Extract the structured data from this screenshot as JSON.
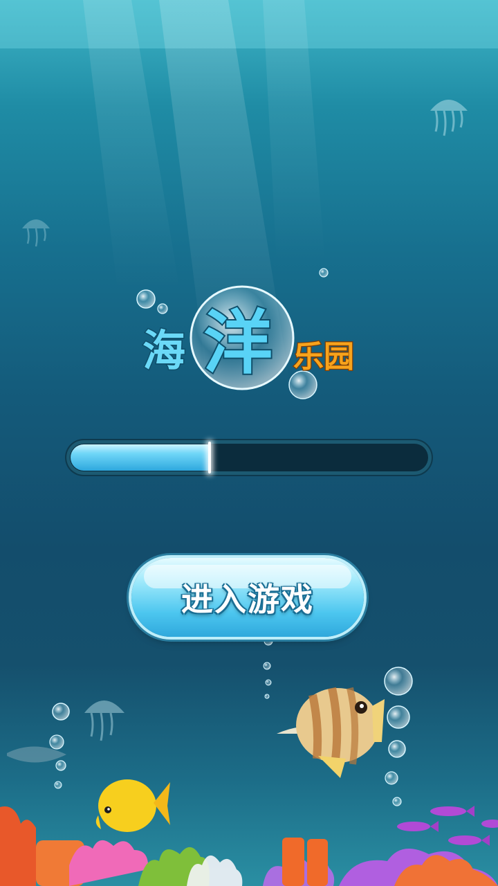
{
  "game": {
    "title_chars": [
      "海",
      "洋",
      "乐园"
    ],
    "enter_button_label": "进入游戏"
  },
  "loading": {
    "progress_fraction": 0.39
  },
  "colors": {
    "title_blue": "#5fd3f5",
    "title_orange": "#f6a21b",
    "button_blue": "#4cc6ef",
    "progress_fill": "#2ea8de"
  },
  "icons": [
    "jellyfish-icon",
    "bubble-icon",
    "butterflyfish-icon",
    "yellow-tang-icon",
    "purple-fish-icon",
    "coral-reef-icon"
  ]
}
